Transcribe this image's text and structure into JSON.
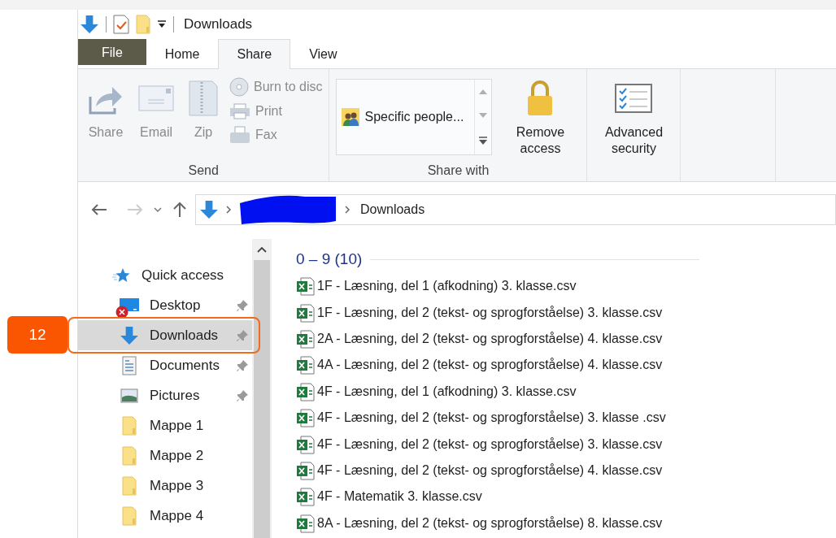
{
  "window": {
    "title": "Downloads"
  },
  "ribbon_tabs": [
    {
      "label": "File",
      "kind": "file",
      "selected": false
    },
    {
      "label": "Home",
      "kind": "tab",
      "selected": false
    },
    {
      "label": "Share",
      "kind": "tab",
      "selected": true
    },
    {
      "label": "View",
      "kind": "tab",
      "selected": false
    }
  ],
  "ribbon_groups": [
    {
      "label": "Send",
      "buttons": [
        {
          "kind": "share",
          "label": "Share",
          "disabled": true
        },
        {
          "kind": "email",
          "label": "Email",
          "disabled": true
        },
        {
          "kind": "zip",
          "label": "Zip",
          "disabled": true
        }
      ],
      "small_buttons": [
        {
          "kind": "disc",
          "label": "Burn to disc",
          "disabled": true
        },
        {
          "kind": "print",
          "label": "Print",
          "disabled": true
        },
        {
          "kind": "fax",
          "label": "Fax",
          "disabled": true
        }
      ]
    },
    {
      "label": "Share with",
      "gallery": [
        {
          "kind": "people",
          "label": "Specific people..."
        }
      ],
      "buttons": [
        {
          "kind": "lock",
          "label": "Remove access",
          "disabled": false
        }
      ]
    },
    {
      "buttons": [
        {
          "kind": "security",
          "label": "Advanced security",
          "disabled": false
        }
      ]
    }
  ],
  "address_bar": {
    "path": [
      {
        "kind": "redacted"
      },
      {
        "kind": "folder",
        "label": "Downloads"
      }
    ]
  },
  "nav_pane": {
    "items": [
      {
        "kind": "quick",
        "label": "Quick access",
        "selected": false,
        "pinned": false,
        "error": false,
        "children": [
          {
            "kind": "desktop",
            "label": "Desktop",
            "selected": false,
            "pinned": true,
            "error": true
          },
          {
            "kind": "downloads",
            "label": "Downloads",
            "selected": true,
            "pinned": true,
            "error": false
          },
          {
            "kind": "documents",
            "label": "Documents",
            "selected": false,
            "pinned": true,
            "error": false
          },
          {
            "kind": "pictures",
            "label": "Pictures",
            "selected": false,
            "pinned": true,
            "error": false
          },
          {
            "kind": "folder",
            "label": "Mappe 1",
            "selected": false,
            "pinned": false,
            "error": false
          },
          {
            "kind": "folder",
            "label": "Mappe 2",
            "selected": false,
            "pinned": false,
            "error": false
          },
          {
            "kind": "folder",
            "label": "Mappe 3",
            "selected": false,
            "pinned": false,
            "error": false
          },
          {
            "kind": "folder",
            "label": "Mappe 4",
            "selected": false,
            "pinned": false,
            "error": false
          }
        ]
      }
    ]
  },
  "callout": {
    "label": "12"
  },
  "file_group": {
    "heading": "0 – 9 (10)",
    "files": [
      {
        "kind": "csv",
        "name": "1F - Læsning, del 1 (afkodning) 3. klasse.csv"
      },
      {
        "kind": "csv",
        "name": "1F - Læsning, del 2 (tekst- og sprogforståelse) 3. klasse.csv"
      },
      {
        "kind": "csv",
        "name": "2A - Læsning, del 2 (tekst- og sprogforståelse) 4. klasse.csv"
      },
      {
        "kind": "csv",
        "name": "4A - Læsning, del 2 (tekst- og sprogforståelse) 4. klasse.csv"
      },
      {
        "kind": "csv",
        "name": "4F - Læsning, del 1 (afkodning) 3. klasse.csv"
      },
      {
        "kind": "csv",
        "name": "4F - Læsning, del 2 (tekst- og sprogforståelse) 3. klasse .csv"
      },
      {
        "kind": "csv",
        "name": "4F - Læsning, del 2 (tekst- og sprogforståelse) 3. klasse.csv"
      },
      {
        "kind": "csv",
        "name": "4F - Læsning, del 2 (tekst- og sprogforståelse) 4. klasse.csv"
      },
      {
        "kind": "csv",
        "name": "4F - Matematik 3. klasse.csv"
      },
      {
        "kind": "csv",
        "name": "8A - Læsning, del 2 (tekst- og sprogforståelse) 8. klasse.csv"
      }
    ]
  }
}
